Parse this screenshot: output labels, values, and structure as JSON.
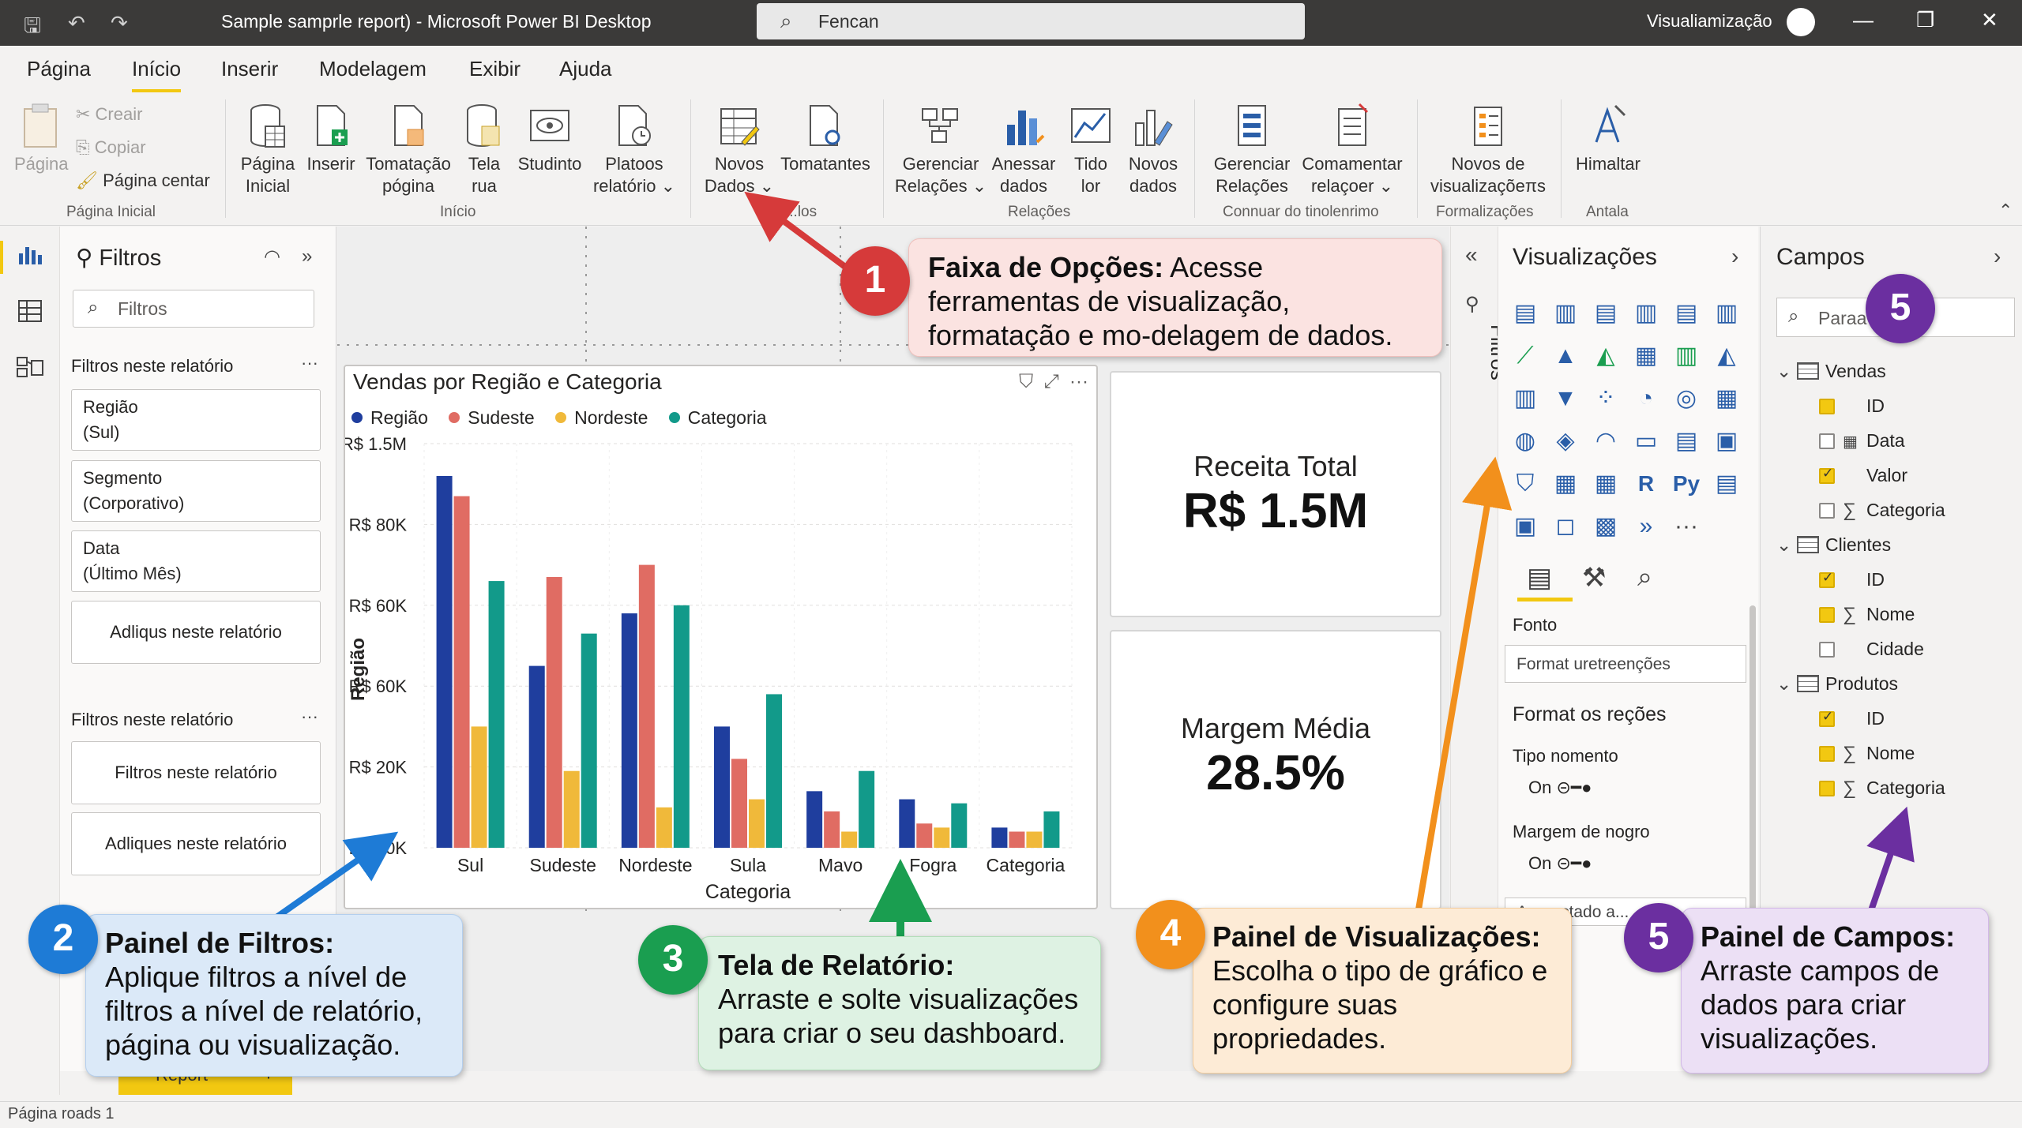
{
  "titlebar": {
    "title": "Sample samprle report) - Microsoft Power BI Desktop",
    "search": "Fencan",
    "user": "Visualiamização"
  },
  "menu": {
    "tabs": [
      "Página",
      "Início",
      "Inserir",
      "Modelagem",
      "Exibir",
      "Ajuda"
    ],
    "active": "Início"
  },
  "ribbon": {
    "clipboard": {
      "paste": "Página",
      "cut": "Creair",
      "copy": "Copiar",
      "format": "Página centar",
      "group": "Página Inicial"
    },
    "inicio": {
      "buttons": [
        {
          "l1": "Página",
          "l2": "Inicial"
        },
        {
          "l1": "Inserir",
          "l2": ""
        },
        {
          "l1": "Tomatação",
          "l2": "pógina"
        },
        {
          "l1": "Tela",
          "l2": "rua"
        },
        {
          "l1": "Studinto",
          "l2": ""
        },
        {
          "l1": "Platoos",
          "l2": "relatório ⌄"
        }
      ],
      "group": "Início"
    },
    "dados": {
      "buttons": [
        {
          "l1": "Novos",
          "l2": "Dados ⌄"
        },
        {
          "l1": "Tomatantes",
          "l2": ""
        }
      ],
      "group": "...los"
    },
    "relacoes": {
      "buttons": [
        {
          "l1": "Gerenciar",
          "l2": "Relações ⌄"
        },
        {
          "l1": "Anessar",
          "l2": "dados"
        },
        {
          "l1": "Tido",
          "l2": "lor"
        },
        {
          "l1": "Novos",
          "l2": "dados"
        }
      ],
      "group": "Relações"
    },
    "conn": {
      "buttons": [
        {
          "l1": "Gerenciar",
          "l2": "Relações"
        },
        {
          "l1": "Comamentar",
          "l2": "relaçoer ⌄"
        }
      ],
      "group": "Connuar do tinolenrimo"
    },
    "formal": {
      "buttons": [
        {
          "l1": "Novos de",
          "l2": "visualizaçõeπs"
        }
      ],
      "group": "Formalizações"
    },
    "antala": {
      "buttons": [
        {
          "l1": "Himaltar",
          "l2": ""
        }
      ],
      "group": "Antala"
    }
  },
  "filters": {
    "title": "Filtros",
    "search_placeholder": "Filtros",
    "section1": "Filtros neste relatório",
    "cards1": [
      {
        "l1": "Região",
        "l2": "(Sul)"
      },
      {
        "l1": "Segmento",
        "l2": "(Corporativo)"
      },
      {
        "l1": "Data",
        "l2": "(Último Mês)"
      }
    ],
    "add1": "Adliqus neste relatório",
    "section2": "Filtros neste relatório",
    "card2": "Filtros neste relatório",
    "add2": "Adliques neste relatório",
    "more": "···"
  },
  "chart": {
    "title": "Vendas por Região e Categoria",
    "legend": [
      "Região",
      "Sudeste",
      "Nordeste",
      "Categoria"
    ]
  },
  "chart_data": {
    "type": "bar",
    "title": "Vendas por Região e Categoria",
    "xlabel": "Categoria",
    "ylabel": "Região",
    "categories": [
      "Sul",
      "Sudeste",
      "Nordeste",
      "Sula",
      "Mavo",
      "Fogra",
      "Categoria"
    ],
    "ytick_labels": [
      "R$ 00K",
      "R$ 20K",
      "R$ 60K",
      "R$ 60K",
      "R$ 80K",
      "R$ 1.5M"
    ],
    "ylim": [
      0,
      100
    ],
    "series": [
      {
        "name": "Região",
        "color": "#1f3e9e",
        "values": [
          92,
          45,
          58,
          30,
          14,
          12,
          5
        ]
      },
      {
        "name": "Sudeste",
        "color": "#e06c63",
        "values": [
          87,
          67,
          70,
          22,
          9,
          6,
          4
        ]
      },
      {
        "name": "Nordeste",
        "color": "#f0b93a",
        "values": [
          30,
          19,
          10,
          12,
          4,
          5,
          4
        ]
      },
      {
        "name": "Categoria",
        "color": "#129a8a",
        "values": [
          66,
          53,
          60,
          38,
          19,
          11,
          9
        ]
      }
    ],
    "grid": true,
    "legend_position": "top-left"
  },
  "kpis": [
    {
      "label": "Receita Total",
      "value": "R$ 1.5M"
    },
    {
      "label": "Margem Média",
      "value": "28.5%"
    }
  ],
  "viz": {
    "collapsed_label": "Filtros",
    "title": "Visualizações",
    "font_label": "Fonto",
    "format_input": "Format uretreenções",
    "format_section": "Format os reções",
    "tipo_label": "Tipo nomento",
    "toggle1": "On",
    "margem_label": "Margem de nogro",
    "toggle2": "On",
    "cut_text": "Axxxxctado a..."
  },
  "fields": {
    "title": "Campos",
    "search_placeholder": "Paraa",
    "tables": [
      {
        "name": "Vendas",
        "fields": [
          {
            "name": "ID",
            "state": "yellow",
            "sigma": false
          },
          {
            "name": "Data",
            "state": "empty",
            "sigma": false,
            "calendar": true
          },
          {
            "name": "Valor",
            "state": "checked",
            "sigma": false
          },
          {
            "name": "Categoria",
            "state": "empty",
            "sigma": true
          }
        ]
      },
      {
        "name": "Clientes",
        "fields": [
          {
            "name": "ID",
            "state": "checked",
            "sigma": false
          },
          {
            "name": "Nome",
            "state": "yellow",
            "sigma": true
          },
          {
            "name": "Cidade",
            "state": "empty",
            "sigma": false
          }
        ]
      },
      {
        "name": "Produtos",
        "fields": [
          {
            "name": "ID",
            "state": "checked",
            "sigma": false
          },
          {
            "name": "Nome",
            "state": "yellow",
            "sigma": true
          },
          {
            "name": "Categoria",
            "state": "yellow",
            "sigma": true
          }
        ]
      }
    ]
  },
  "page_tab": "Report",
  "status": "Página roads 1",
  "callouts": [
    {
      "num": "1",
      "title": "Faixa de Opções:",
      "text": " Acesse ferramentas de visualização, formatação e mo-delagem de dados.",
      "color": "#d63a3a",
      "bg": "#fbe3e1"
    },
    {
      "num": "2",
      "title": "Painel de Filtros:",
      "text": "Aplique filtros a nível de filtros a nível de relatório, página ou visualização.",
      "color": "#1e7bd6",
      "bg": "#dbe9f8"
    },
    {
      "num": "3",
      "title": "Tela de Relatório:",
      "text": "Arraste e solte visualizações para criar o seu dashboard.",
      "color": "#1a9e50",
      "bg": "#def2e3"
    },
    {
      "num": "4",
      "title": "Painel de Visualizações:",
      "text": "Escolha o tipo de gráfico e configure suas propriedades.",
      "color": "#f2901c",
      "bg": "#fdebd6"
    },
    {
      "num": "5",
      "title": "Painel de Campos:",
      "text": "Arraste campos de dados para criar visualizações.",
      "color": "#6b2fa0",
      "bg": "#ece0f5"
    }
  ],
  "badge5_top": "5"
}
